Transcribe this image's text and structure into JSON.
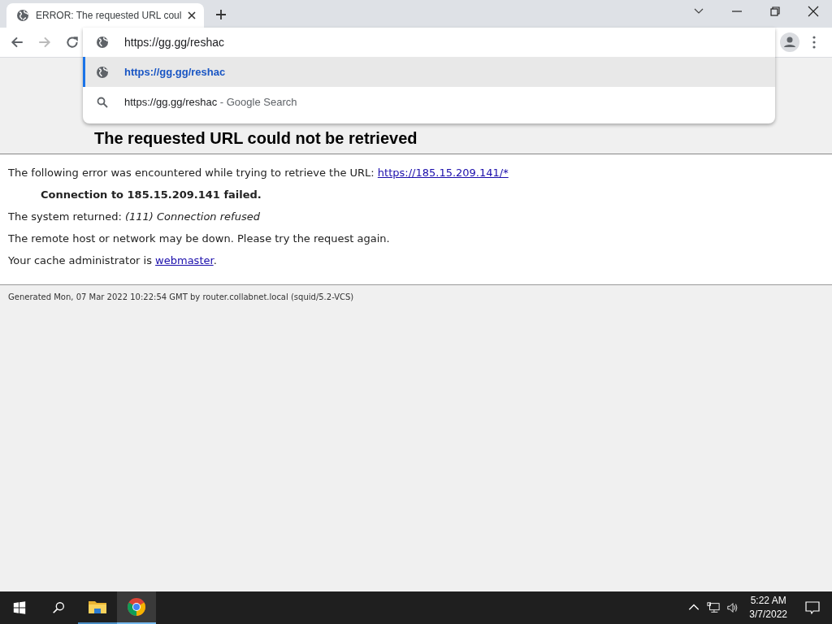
{
  "tabs": [
    {
      "title": "ERROR: The requested URL coul",
      "selected": true
    }
  ],
  "omnibox": {
    "value": "https://gg.gg/reshac"
  },
  "suggestions": [
    {
      "kind": "url",
      "text": "https://gg.gg/reshac",
      "selected": true
    },
    {
      "kind": "search",
      "text": "https://gg.gg/reshac",
      "suffix": " - Google Search",
      "selected": false
    }
  ],
  "page": {
    "heading": "The requested URL could not be retrieved",
    "intro": "The following error was encountered while trying to retrieve the URL: ",
    "intro_link": "https://185.15.209.141/*",
    "failure": "Connection to 185.15.209.141 failed.",
    "returned_label": "The system returned: ",
    "returned_value": "(111) Connection refused",
    "remote": "The remote host or network may be down. Please try the request again.",
    "admin": "Your cache administrator is ",
    "admin_link": "webmaster",
    "admin_end": ".",
    "footer": "Generated Mon, 07 Mar 2022 10:22:54 GMT by router.collabnet.local (squid/5.2-VCS)"
  },
  "taskbar": {
    "time": "5:22 AM",
    "date": "3/7/2022",
    "apps": [
      {
        "kind": "explorer",
        "active": false
      },
      {
        "kind": "chrome",
        "active": true
      }
    ]
  }
}
